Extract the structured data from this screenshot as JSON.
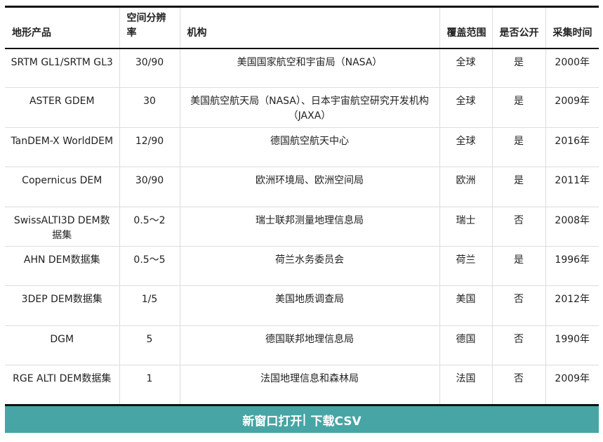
{
  "table": {
    "headers": [
      "地形产品",
      "空间分辨率",
      "机构",
      "覆盖范围",
      "是否公开",
      "采集时间"
    ],
    "rows": [
      [
        "SRTM GL1/SRTM GL3",
        "30/90",
        "美国国家航空和宇宙局（NASA）",
        "全球",
        "是",
        "2000年"
      ],
      [
        "ASTER GDEM",
        "30",
        "美国航空航天局（NASA）、日本宇宙航空研究开发机构（JAXA）",
        "全球",
        "是",
        "2009年"
      ],
      [
        "TanDEM-X WorldDEM",
        "12/90",
        "德国航空航天中心",
        "全球",
        "是",
        "2016年"
      ],
      [
        "Copernicus DEM",
        "30/90",
        "欧洲环境局、欧洲空间局",
        "欧洲",
        "是",
        "2011年"
      ],
      [
        "SwissALTI3D DEM数据集",
        "0.5～2",
        "瑞士联邦测量地理信息局",
        "瑞士",
        "否",
        "2008年"
      ],
      [
        "AHN DEM数据集",
        "0.5～5",
        "荷兰水务委员会",
        "荷兰",
        "是",
        "1996年"
      ],
      [
        "3DEP DEM数据集",
        "1/5",
        "美国地质调查局",
        "美国",
        "否",
        "2012年"
      ],
      [
        "DGM",
        "5",
        "德国联邦地理信息局",
        "德国",
        "否",
        "1990年"
      ],
      [
        "RGE ALTI DEM数据集",
        "1",
        "法国地理信息和森林局",
        "法国",
        "否",
        "2009年"
      ]
    ]
  },
  "footer": {
    "open_label": "新窗口打开",
    "separator": "|",
    "download_label": " 下载CSV"
  },
  "colors": {
    "footer_bg": "#47a5a5",
    "rule": "#111111",
    "grid": "#dcdcdc"
  }
}
